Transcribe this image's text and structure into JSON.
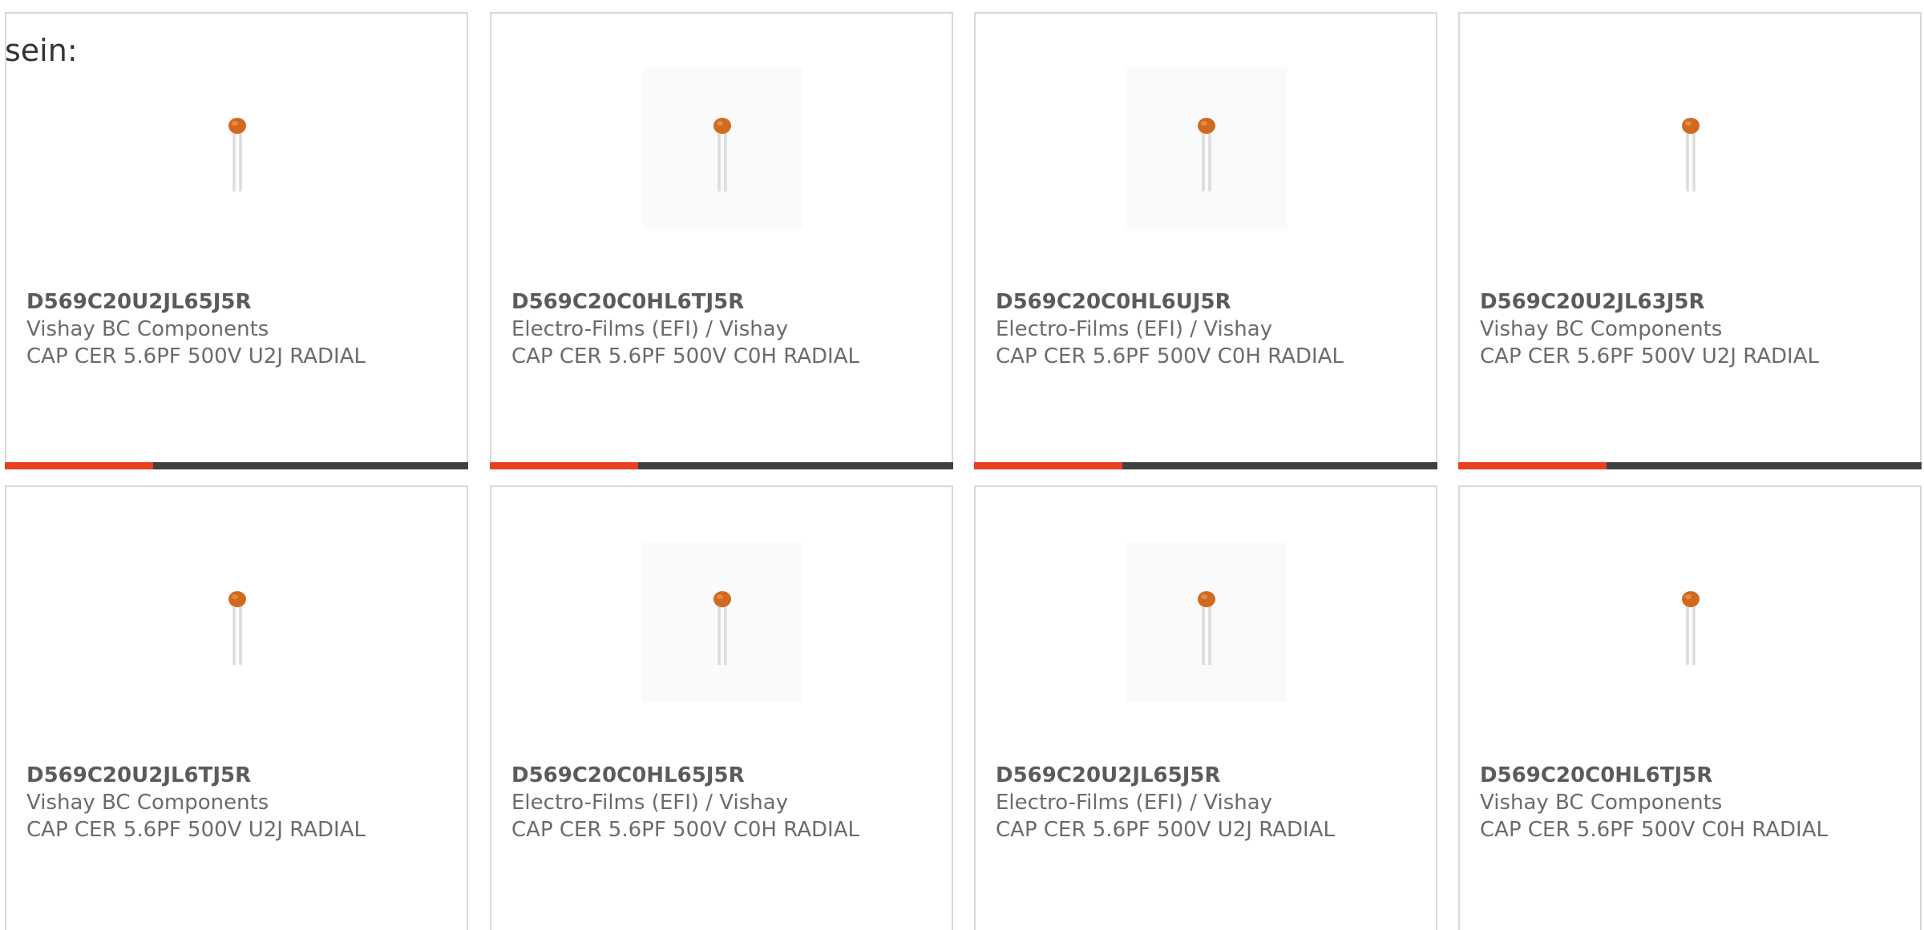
{
  "heading": "sein:",
  "colors": {
    "accent": "#e8401c",
    "bar_track": "#404040",
    "card_border": "#d9d9d9",
    "capacitor_body": "#d2691e"
  },
  "products": [
    {
      "part_number": "D569C20U2JL65J5R",
      "manufacturer": "Vishay BC Components",
      "description": "CAP CER 5.6PF 500V U2J RADIAL",
      "icon": "ceramic-capacitor-icon",
      "progress": 0.32
    },
    {
      "part_number": "D569C20C0HL6TJ5R",
      "manufacturer": "Electro-Films (EFI) / Vishay",
      "description": "CAP CER 5.6PF 500V C0H RADIAL",
      "icon": "ceramic-capacitor-icon",
      "progress": 0.32
    },
    {
      "part_number": "D569C20C0HL6UJ5R",
      "manufacturer": "Electro-Films (EFI) / Vishay",
      "description": "CAP CER 5.6PF 500V C0H RADIAL",
      "icon": "ceramic-capacitor-icon",
      "progress": 0.32
    },
    {
      "part_number": "D569C20U2JL63J5R",
      "manufacturer": "Vishay BC Components",
      "description": "CAP CER 5.6PF 500V U2J RADIAL",
      "icon": "ceramic-capacitor-icon",
      "progress": 0.32
    },
    {
      "part_number": "D569C20U2JL6TJ5R",
      "manufacturer": "Vishay BC Components",
      "description": "CAP CER 5.6PF 500V U2J RADIAL",
      "icon": "ceramic-capacitor-icon"
    },
    {
      "part_number": "D569C20C0HL65J5R",
      "manufacturer": "Electro-Films (EFI) / Vishay",
      "description": "CAP CER 5.6PF 500V C0H RADIAL",
      "icon": "ceramic-capacitor-icon"
    },
    {
      "part_number": "D569C20U2JL65J5R",
      "manufacturer": "Electro-Films (EFI) / Vishay",
      "description": "CAP CER 5.6PF 500V U2J RADIAL",
      "icon": "ceramic-capacitor-icon"
    },
    {
      "part_number": "D569C20C0HL6TJ5R",
      "manufacturer": "Vishay BC Components",
      "description": "CAP CER 5.6PF 500V C0H RADIAL",
      "icon": "ceramic-capacitor-icon"
    }
  ]
}
